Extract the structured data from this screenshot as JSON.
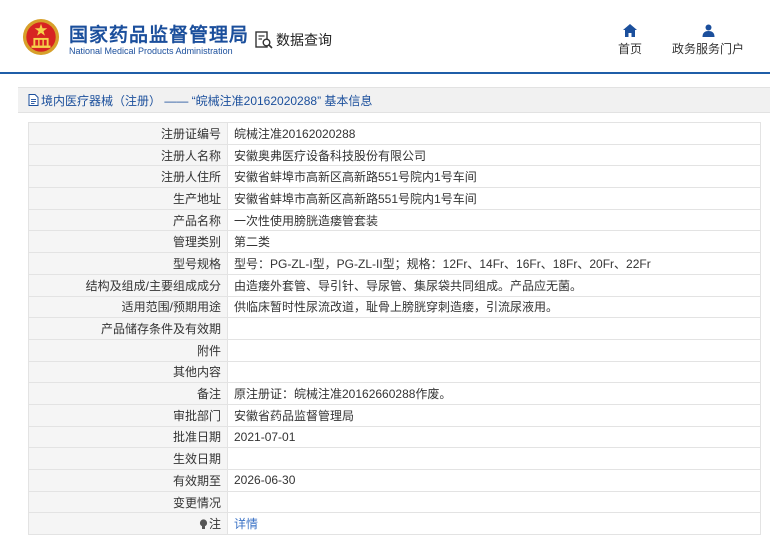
{
  "header": {
    "brand_cn": "国家药品监督管理局",
    "brand_en": "National Medical Products Administration",
    "query_label": "数据查询",
    "nav": [
      {
        "label": "首页",
        "icon": "home-icon"
      },
      {
        "label": "政务服务门户",
        "icon": "user-icon"
      }
    ]
  },
  "title_bar": {
    "text": "境内医疗器械（注册） ——  “皖械注准20162020288” 基本信息",
    "icon": "document-icon"
  },
  "rows": [
    {
      "label": "注册证编号",
      "value": "皖械注准20162020288"
    },
    {
      "label": "注册人名称",
      "value": "安徽奥弗医疗设备科技股份有限公司"
    },
    {
      "label": "注册人住所",
      "value": "安徽省蚌埠市高新区高新路551号院内1号车间"
    },
    {
      "label": "生产地址",
      "value": "安徽省蚌埠市高新区高新路551号院内1号车间"
    },
    {
      "label": "产品名称",
      "value": "一次性使用膀胱造瘘管套装"
    },
    {
      "label": "管理类别",
      "value": "第二类"
    },
    {
      "label": "型号规格",
      "value": "型号：PG-ZL-I型，PG-ZL-II型；规格：12Fr、14Fr、16Fr、18Fr、20Fr、22Fr"
    },
    {
      "label": "结构及组成/主要组成成分",
      "value": "由造瘘外套管、导引针、导尿管、集尿袋共同组成。产品应无菌。"
    },
    {
      "label": "适用范围/预期用途",
      "value": "供临床暂时性尿流改道，耻骨上膀胱穿刺造瘘，引流尿液用。"
    },
    {
      "label": "产品储存条件及有效期",
      "value": ""
    },
    {
      "label": "附件",
      "value": ""
    },
    {
      "label": "其他内容",
      "value": ""
    },
    {
      "label": "备注",
      "value": "原注册证：皖械注准20162660288作废。"
    },
    {
      "label": "审批部门",
      "value": "安徽省药品监督管理局"
    },
    {
      "label": "批准日期",
      "value": "2021-07-01"
    },
    {
      "label": "生效日期",
      "value": ""
    },
    {
      "label": "有效期至",
      "value": "2026-06-30"
    },
    {
      "label": "变更情况",
      "value": ""
    }
  ],
  "note_row": {
    "label": "注",
    "icon": "lightbulb-icon",
    "link_text": "详情"
  },
  "colors": {
    "brand_blue": "#1b4f9c",
    "link_blue": "#3a72c6",
    "label_bg": "#f5f5f5"
  }
}
